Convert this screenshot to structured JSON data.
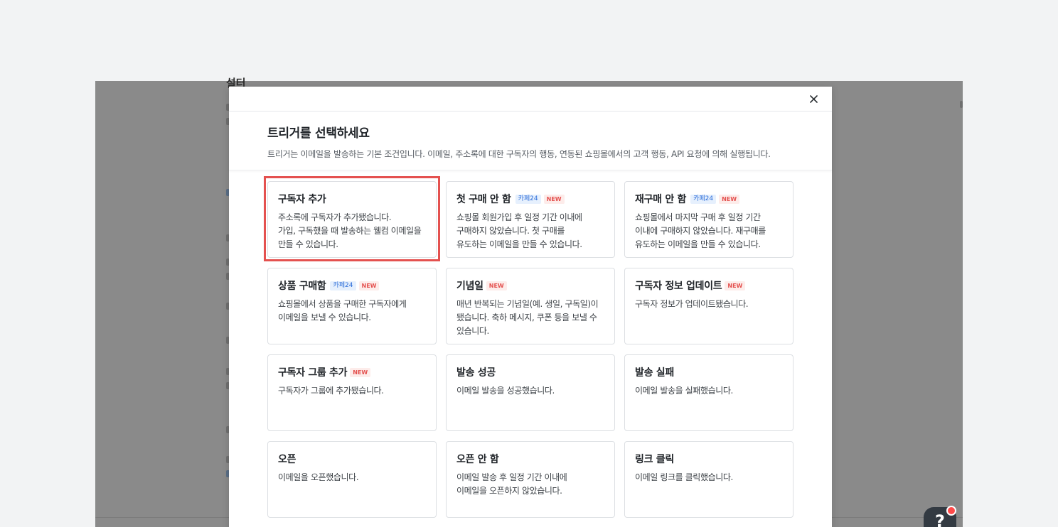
{
  "background": {
    "heading": "설터"
  },
  "modal": {
    "title": "트리거를 선택하세요",
    "description": "트리거는 이메일을 발송하는 기본 조건입니다. 이메일, 주소록에 대한 구독자의 행동, 연동된 쇼핑몰에서의 고객 행동, API 요청에 의해 실행됩니다.",
    "close_icon": "close-icon"
  },
  "triggers": [
    {
      "title": "구독자 추가",
      "cafe24": "",
      "new": "",
      "desc": "주소록에 구독자가 추가됐습니다.\n가입, 구독했을 때 발송하는 웰컴 이메일을\n만들 수 있습니다.",
      "highlighted": true
    },
    {
      "title": "첫 구매 안 함",
      "cafe24": "카페24",
      "new": "NEW",
      "desc": "쇼핑몰 회원가입 후 일정 기간 이내에\n구매하지 않았습니다. 첫 구매를\n유도하는 이메일을 만들 수 있습니다."
    },
    {
      "title": "재구매 안 함",
      "cafe24": "카페24",
      "new": "NEW",
      "desc": "쇼핑몰에서 마지막 구매 후 일정 기간\n이내에 구매하지 않았습니다. 재구매를\n유도하는 이메일을 만들 수 있습니다."
    },
    {
      "title": "상품 구매함",
      "cafe24": "카페24",
      "new": "NEW",
      "desc": "쇼핑몰에서 상품을 구매한 구독자에게\n이메일을 보낼 수 있습니다."
    },
    {
      "title": "기념일",
      "cafe24": "",
      "new": "NEW",
      "desc": "매년 반복되는 기념일(예. 생일, 구독일)이\n됐습니다. 축하 메시지, 쿠폰 등을 보낼 수\n있습니다."
    },
    {
      "title": "구독자 정보 업데이트",
      "cafe24": "",
      "new": "NEW",
      "desc": "구독자 정보가 업데이트됐습니다."
    },
    {
      "title": "구독자 그룹 추가",
      "cafe24": "",
      "new": "NEW",
      "desc": "구독자가 그룹에 추가됐습니다."
    },
    {
      "title": "발송 성공",
      "cafe24": "",
      "new": "",
      "desc": "이메일 발송을 성공했습니다."
    },
    {
      "title": "발송 실패",
      "cafe24": "",
      "new": "",
      "desc": "이메일 발송을 실패했습니다."
    },
    {
      "title": "오픈",
      "cafe24": "",
      "new": "",
      "desc": "이메일을 오픈했습니다."
    },
    {
      "title": "오픈 안 함",
      "cafe24": "",
      "new": "",
      "desc": "이메일 발송 후 일정 기간 이내에\n이메일을 오픈하지 않았습니다."
    },
    {
      "title": "링크 클릭",
      "cafe24": "",
      "new": "",
      "desc": "이메일 링크를 클릭했습니다."
    }
  ],
  "help": {
    "glyph": "?",
    "icon": "help-question-icon"
  },
  "colors": {
    "highlight": "#e4514f",
    "cafe24_badge": "#2b6cd9",
    "new_badge": "#e4514f",
    "overlay": "#8a8a8a"
  }
}
